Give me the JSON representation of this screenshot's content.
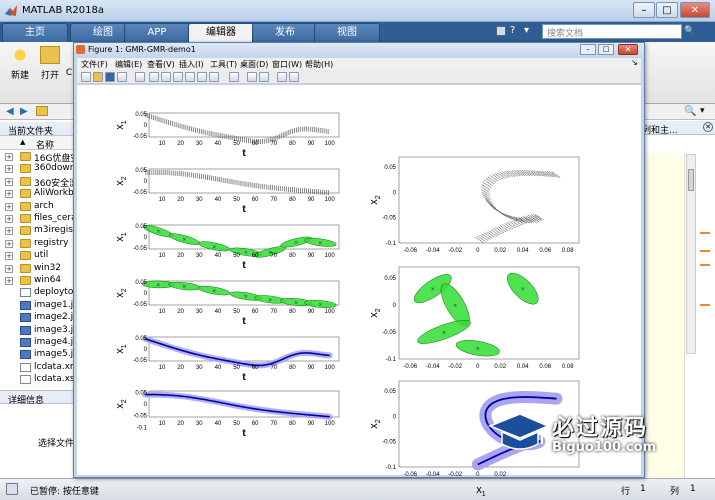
{
  "app": {
    "title": "MATLAB R2018a"
  },
  "ribbon_tabs": [
    "主页",
    "绘图",
    "APP",
    "编辑器",
    "发布",
    "视图"
  ],
  "active_tab": "编辑器",
  "search": {
    "placeholder": "搜索文档"
  },
  "ribbon": {
    "new_label": "新建",
    "open_label": "打开",
    "more_label": "C"
  },
  "left_panel": {
    "header": "当前文件夹",
    "name_column": "名称",
    "files": [
      {
        "name": "16G优盘安",
        "type": "folder"
      },
      {
        "name": "360downl",
        "type": "folder"
      },
      {
        "name": "360安全浏",
        "type": "folder"
      },
      {
        "name": "AliWorkbe",
        "type": "folder"
      },
      {
        "name": "arch",
        "type": "folder"
      },
      {
        "name": "files_cera",
        "type": "folder"
      },
      {
        "name": "m3iregist",
        "type": "folder"
      },
      {
        "name": "registry",
        "type": "folder"
      },
      {
        "name": "util",
        "type": "folder"
      },
      {
        "name": "win32",
        "type": "folder"
      },
      {
        "name": "win64",
        "type": "folder"
      },
      {
        "name": "deploytoo",
        "type": "mfile"
      },
      {
        "name": "image1.jp",
        "type": "img"
      },
      {
        "name": "image2.jp",
        "type": "img"
      },
      {
        "name": "image3.jp",
        "type": "img"
      },
      {
        "name": "image4.jp",
        "type": "img"
      },
      {
        "name": "image5.jp",
        "type": "img"
      },
      {
        "name": "lcdata.xm",
        "type": "xml"
      },
      {
        "name": "lcdata.xsd",
        "type": "xml"
      }
    ],
    "details_header": "详细信息",
    "details_text": "选择文件"
  },
  "right_panel": {
    "label": "列和主..."
  },
  "status": {
    "text": "已暂停: 按任意键",
    "row_label": "行",
    "row_value": "1",
    "col_label": "列",
    "col_value": "1"
  },
  "figure": {
    "title": "Figure 1: GMR-GMR-demo1",
    "menu": [
      "文件(F)",
      "编辑(E)",
      "查看(V)",
      "插入(I)",
      "工具(T)",
      "桌面(D)",
      "窗口(W)",
      "帮助(H)"
    ],
    "x_ticks_t": [
      "10",
      "20",
      "30",
      "40",
      "50",
      "60",
      "70",
      "80",
      "90",
      "100"
    ],
    "y_ticks_t": [
      "0.05",
      "0",
      "-0.05"
    ],
    "y_ticks_t2": [
      "0.05",
      "0",
      "-0.05",
      "-0.1"
    ],
    "x_ticks_xy": [
      "-0.06",
      "-0.04",
      "-0.02",
      "0",
      "0.02",
      "0.04",
      "0.06",
      "0.08"
    ],
    "x_ticks_xy_bottom": [
      "-0.06",
      "-0.04",
      "-0.02",
      "0",
      "0.02"
    ],
    "y_ticks_xy": [
      "0.05",
      "0",
      "-0.05",
      "-0.1"
    ],
    "lbl_x1": "x",
    "lbl_x2": "x",
    "sub1": "1",
    "sub2": "2",
    "lbl_t": "t",
    "colors": {
      "data": "#555555",
      "gmm_fill": "#33dd33",
      "gmm_edge": "#117711",
      "gmr_fill": "#a9a6ee",
      "gmr_line": "#0000aa"
    }
  },
  "watermark": {
    "cn": "必过源码",
    "en": "Biguo100.com"
  }
}
